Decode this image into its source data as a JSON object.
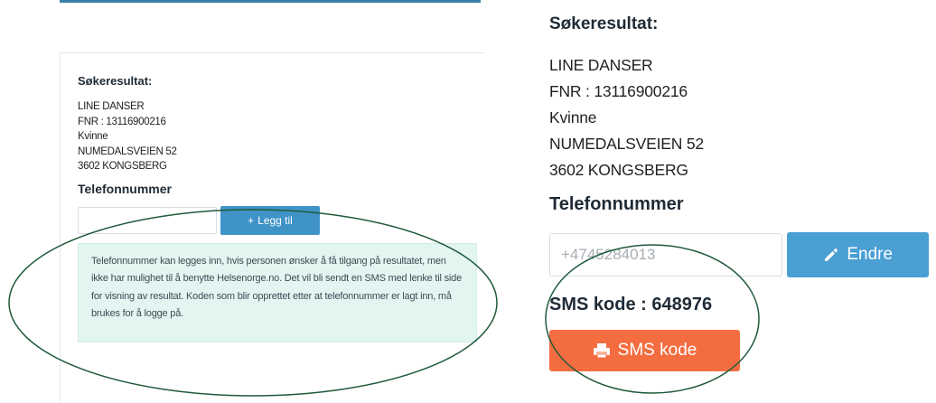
{
  "left": {
    "title": "Søkeresultat:",
    "person": {
      "name": "LINE DANSER",
      "fnr": "FNR : 13116900216",
      "gender": "Kvinne",
      "address": "NUMEDALSVEIEN 52",
      "postal": "3602 KONGSBERG"
    },
    "phone_title": "Telefonnummer",
    "phone_input": {
      "value": "",
      "placeholder": ""
    },
    "add_button": {
      "icon": "plus-icon",
      "label": "Legg til"
    },
    "info_text": "Telefonnummer kan legges inn, hvis personen ønsker å få tilgang på resultatet, men ikke har mulighet til å benytte Helsenorge.no. Det vil bli sendt en SMS med lenke til side for visning av resultat. Koden som blir opprettet etter at telefonnummer er lagt inn, må brukes for å logge på."
  },
  "right": {
    "title": "Søkeresultat:",
    "person": {
      "name": "LINE DANSER",
      "fnr": "FNR : 13116900216",
      "gender": "Kvinne",
      "address": "NUMEDALSVEIEN 52",
      "postal": "3602 KONGSBERG"
    },
    "phone_title": "Telefonnummer",
    "phone_input": {
      "value": "",
      "placeholder": "+4745284013"
    },
    "edit_button": {
      "icon": "pencil-icon",
      "label": "Endre"
    },
    "sms_code_text": "SMS kode : 648976",
    "sms_button": {
      "icon": "printer-icon",
      "label": "SMS kode"
    }
  },
  "colors": {
    "primary_blue": "#3f93c7",
    "edit_blue": "#4a9fd3",
    "sms_orange": "#f46d41",
    "info_bg": "#e3f5f1",
    "annotation_green": "#1f5a3a"
  }
}
